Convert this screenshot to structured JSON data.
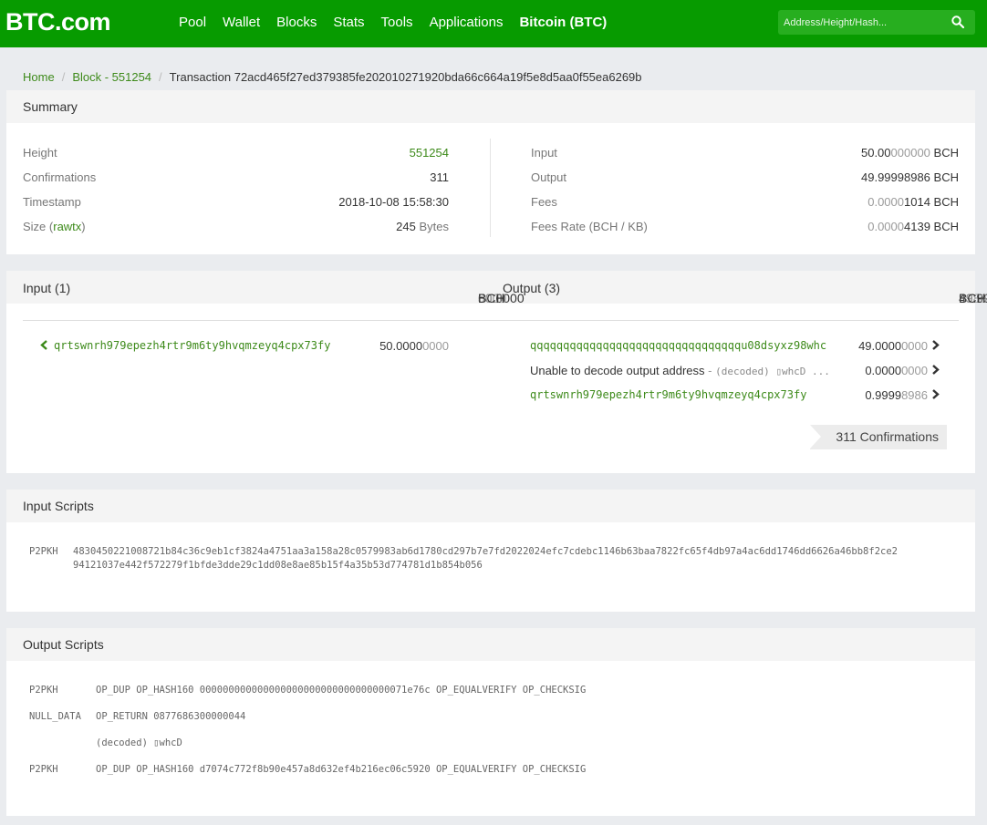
{
  "header": {
    "logo": "BTC.com",
    "nav": [
      "Pool",
      "Wallet",
      "Blocks",
      "Stats",
      "Tools",
      "Applications",
      "Bitcoin (BTC)"
    ],
    "search_placeholder": "Address/Height/Hash..."
  },
  "breadcrumb": {
    "home": "Home",
    "block": "Block - 551254",
    "current": "Transaction 72acd465f27ed379385fe202010271920bda66c664a19f5e8d5aa0f55ea6269b"
  },
  "summary": {
    "title": "Summary",
    "height_label": "Height",
    "height_value": "551254",
    "confirmations_label": "Confirmations",
    "confirmations_value": "311",
    "timestamp_label": "Timestamp",
    "timestamp_value": "2018-10-08 15:58:30",
    "size_label_prefix": "Size (",
    "size_label_link": "rawtx",
    "size_label_suffix": ")",
    "size_value": "245",
    "size_unit": "Bytes",
    "input_label": "Input",
    "input_value_main": "50.00",
    "input_value_dim": "000000",
    "input_unit": "BCH",
    "output_label": "Output",
    "output_value_main": "49.99998986",
    "output_unit": "BCH",
    "fees_label": "Fees",
    "fees_value_main": "0.0000",
    "fees_value_dark": "1014",
    "fees_unit": "BCH",
    "feerate_label": "Fees Rate (BCH / KB)",
    "feerate_value_main": "0.0000",
    "feerate_value_dark": "4139",
    "feerate_unit": "BCH"
  },
  "io": {
    "input_title": "Input (1)",
    "input_total_main": "50.0000",
    "input_total_dim": "0000",
    "input_total_unit": "BCH",
    "output_title": "Output (3)",
    "output_total_main": "49.9999",
    "output_total_dim": "8986",
    "output_total_unit": "BCH",
    "inputs": [
      {
        "address": "qrtswnrh979epezh4rtr9m6ty9hvqmzeyq4cpx73fy",
        "value_main": "50.0000",
        "value_dim": "0000"
      }
    ],
    "outputs": [
      {
        "address": "qqqqqqqqqqqqqqqqqqqqqqqqqqqqqqqqu08dsyxz98whc",
        "value_main": "49.0000",
        "value_dim": "0000"
      },
      {
        "prefix": "Unable to decode output address",
        "sep": " - ",
        "decoded": "(decoded) ▯whcD ...",
        "value_main": "0.0000",
        "value_dim": "0000"
      },
      {
        "address": "qrtswnrh979epezh4rtr9m6ty9hvqmzeyq4cpx73fy",
        "value_main": "0.9999",
        "value_dim": "8986"
      }
    ],
    "confirmations_badge": "311 Confirmations"
  },
  "input_scripts": {
    "title": "Input Scripts",
    "type": "P2PKH",
    "line1": "4830450221008721b84c36c9eb1cf3824a4751aa3a158a28c0579983ab6d1780cd297b7e7fd2022024efc7cdebc1146b63baa7822fc65f4db97a4ac6dd1746dd6626a46bb8f2ce2",
    "line2": "94121037e442f572279f1bfde3dde29c1dd08e8ae85b15f4a35b53d774781d1b854b056"
  },
  "output_scripts": {
    "title": "Output Scripts",
    "rows": [
      {
        "type": "P2PKH",
        "script": "OP_DUP OP_HASH160 000000000000000000000000000000000071e76c OP_EQUALVERIFY OP_CHECKSIG"
      },
      {
        "type": "NULL_DATA",
        "script": "OP_RETURN 0877686300000044"
      },
      {
        "type": "",
        "script": "(decoded) ▯whcD"
      },
      {
        "type": "P2PKH",
        "script": "OP_DUP OP_HASH160 d7074c772f8b90e457a8d632ef4b216ec06c5920 OP_EQUALVERIFY OP_CHECKSIG"
      }
    ]
  },
  "colors": {
    "header_green": "#079b00",
    "link_green": "#3d8a1a"
  }
}
